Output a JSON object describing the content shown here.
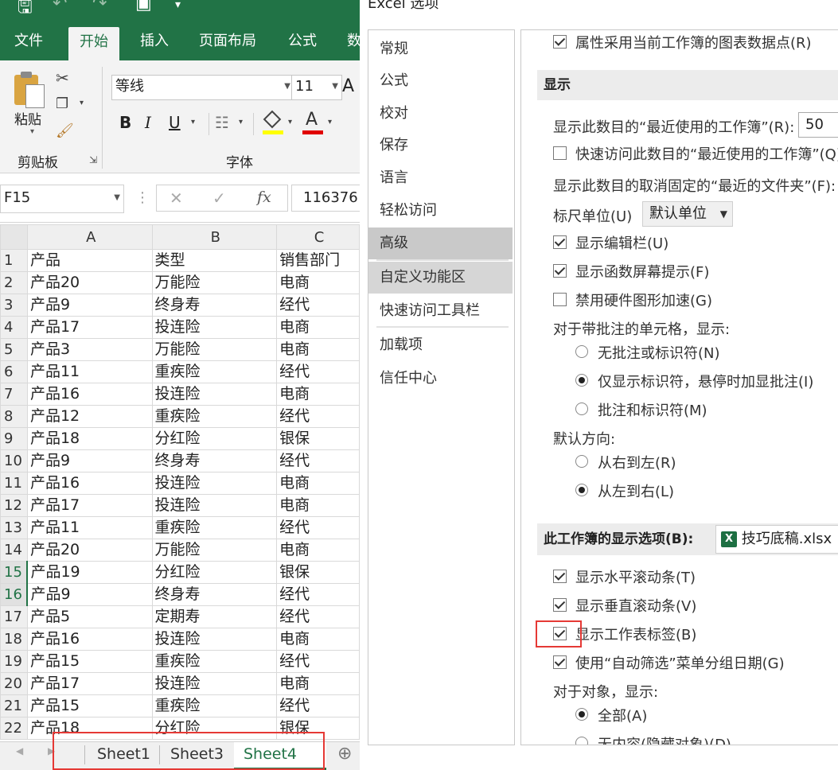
{
  "dialog_title": "Excel 选项",
  "ribbon_tabs": [
    "文件",
    "开始",
    "插入",
    "页面布局",
    "公式",
    "数"
  ],
  "ribbon": {
    "paste_label": "粘贴",
    "clipboard_label": "剪贴板",
    "font_label": "字体",
    "font_name": "等线",
    "font_size": "11",
    "bold": "B",
    "italic": "I",
    "underline": "U",
    "font_color_letter": "A",
    "grow_font": "A"
  },
  "formula_bar": {
    "name_box": "F15",
    "fx": "fx",
    "value": "116376"
  },
  "grid": {
    "columns": [
      "A",
      "B",
      "C"
    ],
    "selected_rows": [
      "15",
      "16"
    ],
    "rows": [
      {
        "num": "1",
        "a": "产品",
        "b": "类型",
        "c": "销售部门"
      },
      {
        "num": "2",
        "a": "产品20",
        "b": "万能险",
        "c": "电商"
      },
      {
        "num": "3",
        "a": "产品9",
        "b": "终身寿",
        "c": "经代"
      },
      {
        "num": "4",
        "a": "产品17",
        "b": "投连险",
        "c": "电商"
      },
      {
        "num": "5",
        "a": "产品3",
        "b": "万能险",
        "c": "电商"
      },
      {
        "num": "6",
        "a": "产品11",
        "b": "重疾险",
        "c": "经代"
      },
      {
        "num": "7",
        "a": "产品16",
        "b": "投连险",
        "c": "电商"
      },
      {
        "num": "8",
        "a": "产品12",
        "b": "重疾险",
        "c": "经代"
      },
      {
        "num": "9",
        "a": "产品18",
        "b": "分红险",
        "c": "银保"
      },
      {
        "num": "10",
        "a": "产品9",
        "b": "终身寿",
        "c": "经代"
      },
      {
        "num": "11",
        "a": "产品16",
        "b": "投连险",
        "c": "电商"
      },
      {
        "num": "12",
        "a": "产品17",
        "b": "投连险",
        "c": "电商"
      },
      {
        "num": "13",
        "a": "产品11",
        "b": "重疾险",
        "c": "经代"
      },
      {
        "num": "14",
        "a": "产品20",
        "b": "万能险",
        "c": "电商"
      },
      {
        "num": "15",
        "a": "产品19",
        "b": "分红险",
        "c": "银保"
      },
      {
        "num": "16",
        "a": "产品9",
        "b": "终身寿",
        "c": "经代"
      },
      {
        "num": "17",
        "a": "产品5",
        "b": "定期寿",
        "c": "经代"
      },
      {
        "num": "18",
        "a": "产品16",
        "b": "投连险",
        "c": "电商"
      },
      {
        "num": "19",
        "a": "产品15",
        "b": "重疾险",
        "c": "经代"
      },
      {
        "num": "20",
        "a": "产品17",
        "b": "投连险",
        "c": "电商"
      },
      {
        "num": "21",
        "a": "产品15",
        "b": "重疾险",
        "c": "经代"
      },
      {
        "num": "22",
        "a": "产品18",
        "b": "分红险",
        "c": "银保"
      }
    ]
  },
  "sheet_tabs": [
    "Sheet1",
    "Sheet3",
    "Sheet4"
  ],
  "active_sheet": "Sheet4",
  "nav": [
    "常规",
    "公式",
    "校对",
    "保存",
    "语言",
    "轻松访问",
    "高级",
    "自定义功能区",
    "快速访问工具栏",
    "加载项",
    "信任中心"
  ],
  "active_nav": "高级",
  "options": {
    "chart_datapoints": "属性采用当前工作簿的图表数据点(R)",
    "display_header": "显示",
    "recent_workbooks_label": "显示此数目的“最近使用的工作簿”(R):",
    "recent_workbooks_value": "50",
    "quick_access_recent": "快速访问此数目的“最近使用的工作簿”(Q)",
    "unpinned_folders_label": "显示此数目的取消固定的“最近的文件夹”(F):",
    "ruler_units_label": "标尺单位(U)",
    "ruler_units_value": "默认单位",
    "show_formula_bar": "显示编辑栏(U)",
    "show_function_tooltips": "显示函数屏幕提示(F)",
    "disable_hw_accel": "禁用硬件图形加速(G)",
    "comments_label": "对于带批注的单元格，显示:",
    "no_comments": "无批注或标识符(N)",
    "indicators_only": "仅显示标识符，悬停时加显批注(I)",
    "comments_and_indicators": "批注和标识符(M)",
    "direction_label": "默认方向:",
    "right_to_left": "从右到左(R)",
    "left_to_right": "从左到右(L)",
    "workbook_section": "此工作簿的显示选项(B):",
    "workbook_file": "技巧底稿.xlsx",
    "show_hscroll": "显示水平滚动条(T)",
    "show_vscroll": "显示垂直滚动条(V)",
    "show_sheet_tabs": "显示工作表标签(B)",
    "group_dates": "使用“自动筛选”菜单分组日期(G)",
    "objects_label": "对于对象，显示:",
    "objects_all": "全部(A)",
    "objects_nothing": "无内容(隐藏对象)(D)"
  }
}
